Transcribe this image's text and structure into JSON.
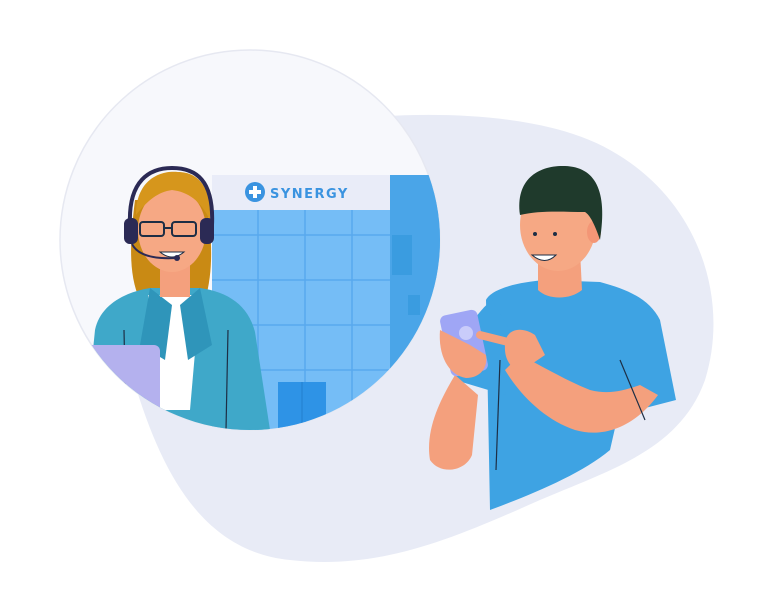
{
  "building_sign": {
    "label": "SYNERGY",
    "icon": "medical-cross-icon"
  },
  "colors": {
    "background_blob": "#e8ebf6",
    "circle_fill": "#f7f8fc",
    "building_blue": "#75bdf6",
    "building_dark": "#3a9ce0",
    "sign_panel": "#e9ecf8",
    "brand_blue": "#3a93e0",
    "agent_jacket": "#3fa8c9",
    "agent_hair": "#c98a14",
    "headset": "#2b2a55",
    "skin": "#f4a07d",
    "man_shirt": "#3ea3e3",
    "man_hair": "#1f3a2c",
    "phone": "#9fa6f5",
    "tablet": "#b4b1ee"
  }
}
